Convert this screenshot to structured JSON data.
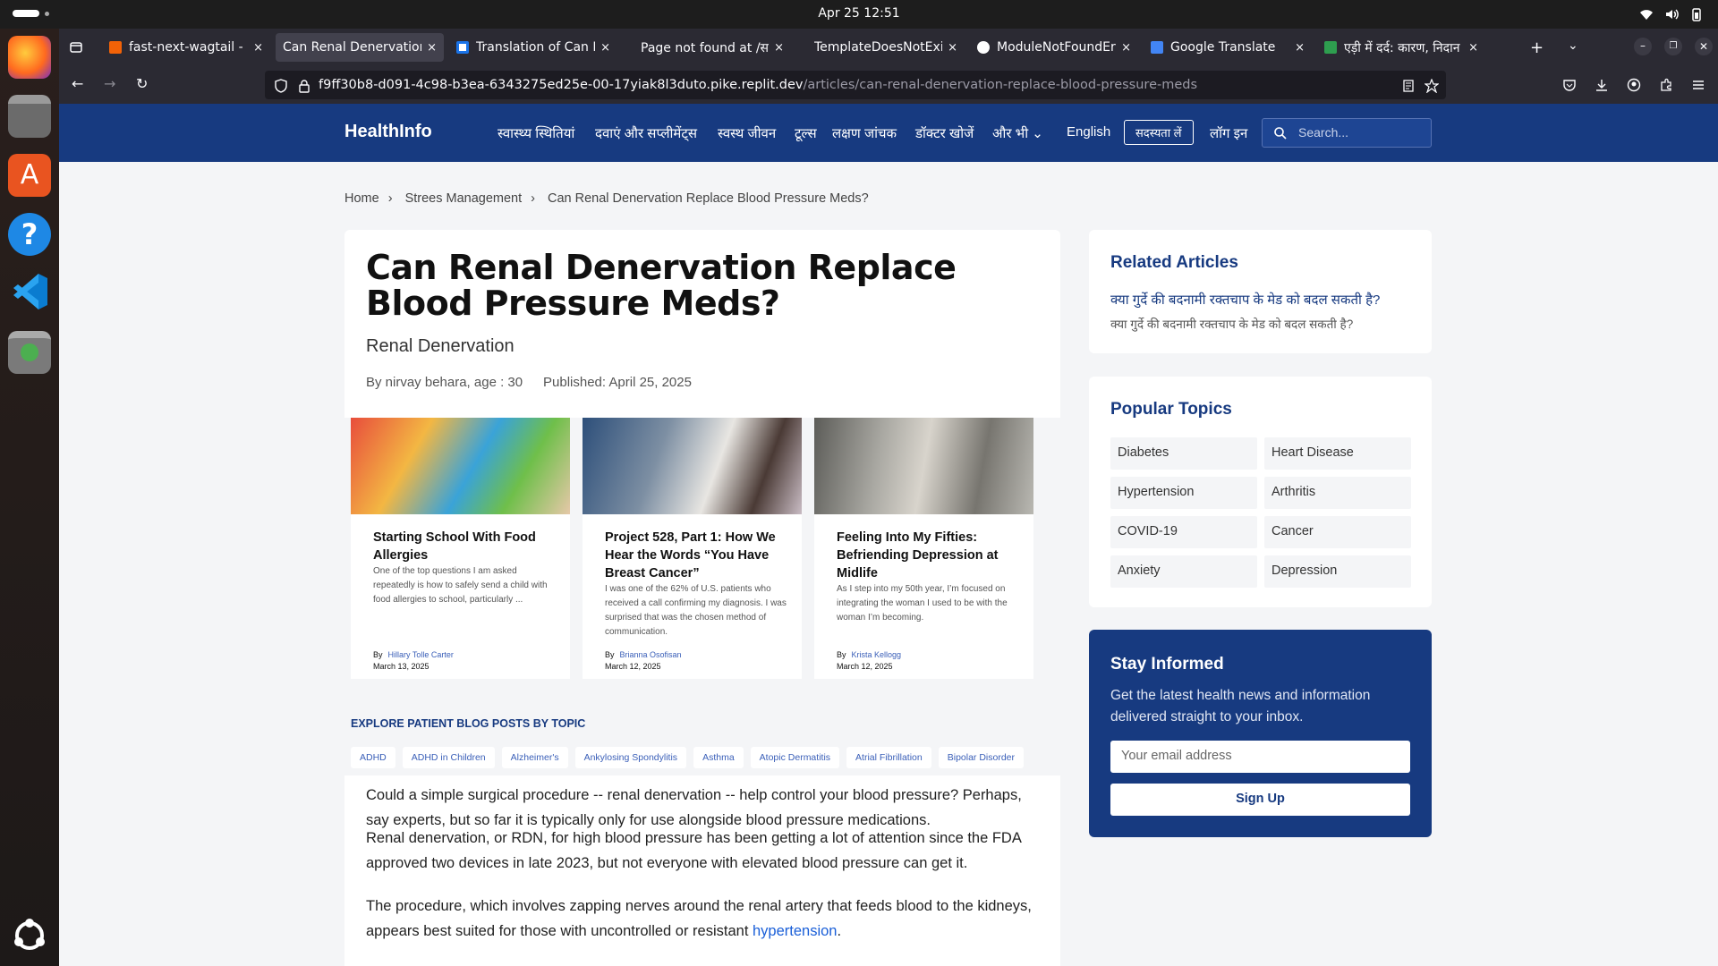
{
  "system": {
    "clock": "Apr 25  12:51"
  },
  "browser": {
    "tabs": [
      {
        "title": "fast-next-wagtail - Re",
        "close": "×"
      },
      {
        "title": "Can Renal Denervation R",
        "close": "×"
      },
      {
        "title": "Translation of Can Re",
        "close": "×"
      },
      {
        "title": "Page not found at /समग्र/",
        "close": "×"
      },
      {
        "title": "TemplateDoesNotExist a",
        "close": "×"
      },
      {
        "title": "ModuleNotFoundErro",
        "close": "×"
      },
      {
        "title": "Google Translate",
        "close": "×"
      },
      {
        "title": "एड़ी में दर्द: कारण, निदान और",
        "close": "×"
      }
    ],
    "url_host": "f9ff30b8-d091-4c98-b3ea-6343275ed25e-00-17yiak8l3duto.pike.replit.dev",
    "url_path": "/articles/can-renal-denervation-replace-blood-pressure-meds"
  },
  "site": {
    "logo": "HealthInfo",
    "nav": [
      "स्वास्थ्य स्थितियां",
      "दवाएं और सप्लीमेंट्स",
      "स्वस्थ जीवन",
      "टूल्स",
      "लक्षण जांचक",
      "डॉक्टर खोजें",
      "और भी"
    ],
    "language": "English",
    "join": "सदस्यता लें",
    "login": "लॉग इन",
    "search_placeholder": "Search..."
  },
  "breadcrumb": [
    "Home",
    "Strees Management",
    "Can Renal Denervation Replace Blood Pressure Meds?"
  ],
  "article": {
    "title": "Can Renal Denervation Replace Blood Pressure Meds?",
    "subtitle": "Renal Denervation",
    "byline": "By nirvay behara, age : 30",
    "published": "Published: April 25, 2025",
    "cards": [
      {
        "title": "Starting School With Food Allergies",
        "excerpt": "One of the top questions I am asked repeatedly is how to safely send a child with food allergies to school, particularly ...",
        "by": "By",
        "author": "Hillary Tolle Carter",
        "date": "March 13, 2025"
      },
      {
        "title": "Project 528, Part 1: How We Hear the Words “You Have Breast Cancer”",
        "excerpt": "I was one of the 62% of U.S. patients who received a call confirming my diagnosis. I was surprised that was the chosen method of communication.",
        "by": "By",
        "author": "Brianna Osofisan",
        "date": "March 12, 2025"
      },
      {
        "title": "Feeling Into My Fifties: Befriending Depression at Midlife",
        "excerpt": "As I step into my 50th year, I’m focused on integrating the woman I used to be with the woman I’m becoming.",
        "by": "By",
        "author": "Krista Kellogg",
        "date": "March 12, 2025"
      }
    ],
    "explore_heading": "EXPLORE PATIENT BLOG POSTS BY TOPIC",
    "topics": [
      "ADHD",
      "ADHD in Children",
      "Alzheimer's",
      "Ankylosing Spondylitis",
      "Asthma",
      "Atopic Dermatitis",
      "Atrial Fibrillation",
      "Bipolar Disorder"
    ],
    "paragraphs": [
      {
        "text": "Could a simple surgical procedure -- renal denervation -- help control your blood pressure? Perhaps, say experts, but so far it is typically only for use alongside blood pressure medications."
      },
      {
        "text": "Renal denervation, or RDN,  for high blood pressure has been getting a lot of attention since the FDA approved two devices in late 2023, but not everyone with elevated blood pressure can get it."
      },
      {
        "text": "The procedure, which involves zapping nerves around the renal artery that feeds blood to the kidneys, appears best suited for those with uncontrolled or resistant ",
        "link": "hypertension",
        "tail": "."
      }
    ]
  },
  "sidebar": {
    "related_heading": "Related Articles",
    "related_title": "क्या गुर्दे की बदनामी रक्तचाप के मेड को बदल सकती है?",
    "related_sub": "क्या गुर्दे की बदनामी रक्तचाप के मेड को बदल सकती है?",
    "popular_heading": "Popular Topics",
    "popular": [
      "Diabetes",
      "Heart Disease",
      "Hypertension",
      "Arthritis",
      "COVID-19",
      "Cancer",
      "Anxiety",
      "Depression"
    ],
    "newsletter": {
      "heading": "Stay Informed",
      "text": "Get the latest health news and information delivered straight to your inbox.",
      "placeholder": "Your email address",
      "button": "Sign Up"
    }
  },
  "colors": {
    "brand": "#173a80",
    "link": "#1a5fd8"
  }
}
